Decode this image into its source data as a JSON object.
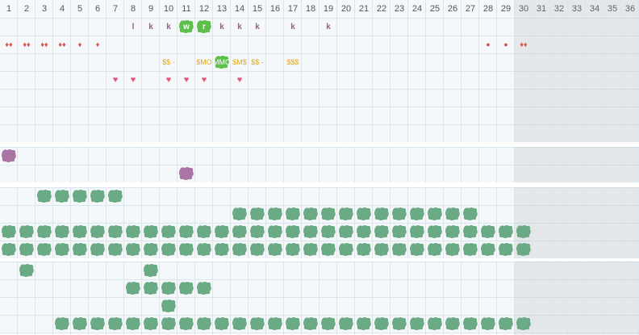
{
  "header": {
    "day_labels": [
      "1",
      "2",
      "3",
      "4",
      "5",
      "6",
      "7",
      "8",
      "9",
      "10",
      "11",
      "12",
      "13",
      "14",
      "15",
      "16",
      "17",
      "18",
      "19",
      "20",
      "21",
      "22",
      "23",
      "24",
      "25",
      "26",
      "27",
      "28",
      "29",
      "30",
      "31",
      "32",
      "33",
      "34",
      "35",
      "36"
    ]
  },
  "colors": {
    "grid_line": "#d8e6ee",
    "cell_bg": "#f4f8fb",
    "weekend_shade": "#ececec",
    "k_letter": "#9b5a8e",
    "drop": "#d9534f",
    "heart": "#e05a7a",
    "money": "#e6a817",
    "highlight_green": "#5cc04a",
    "blob_green": "#6aab85",
    "blob_purple": "#a875a5"
  },
  "rows": {
    "letters": [
      {
        "col": 8,
        "text": "l"
      },
      {
        "col": 9,
        "text": "k"
      },
      {
        "col": 10,
        "text": "k"
      },
      {
        "col": 11,
        "text": "w",
        "highlight": true
      },
      {
        "col": 12,
        "text": "r",
        "highlight": true
      },
      {
        "col": 13,
        "text": "k"
      },
      {
        "col": 14,
        "text": "k"
      },
      {
        "col": 15,
        "text": "k"
      },
      {
        "col": 17,
        "text": "k"
      },
      {
        "col": 19,
        "text": "k"
      }
    ],
    "drops": [
      {
        "col": 1,
        "symbol": "♦♦"
      },
      {
        "col": 2,
        "symbol": "♦♦"
      },
      {
        "col": 3,
        "symbol": "♦♦"
      },
      {
        "col": 4,
        "symbol": "♦♦"
      },
      {
        "col": 5,
        "symbol": "♦"
      },
      {
        "col": 6,
        "symbol": "♦"
      },
      {
        "col": 28,
        "symbol": "●"
      },
      {
        "col": 29,
        "symbol": "●"
      },
      {
        "col": 30,
        "symbol": "♦♦"
      }
    ],
    "money": [
      {
        "col": 10,
        "text": "$$ -"
      },
      {
        "col": 12,
        "text": "$MO"
      },
      {
        "col": 13,
        "text": "MMO",
        "highlight": true
      },
      {
        "col": 14,
        "text": "$M$"
      },
      {
        "col": 15,
        "text": "$$ -"
      },
      {
        "col": 17,
        "text": "$$$"
      }
    ],
    "hearts": [
      {
        "col": 7,
        "symbol": "♥"
      },
      {
        "col": 8,
        "symbol": "♥"
      },
      {
        "col": 10,
        "symbol": "♥"
      },
      {
        "col": 11,
        "symbol": "♥"
      },
      {
        "col": 12,
        "symbol": "♥"
      },
      {
        "col": 14,
        "symbol": "♥"
      }
    ]
  },
  "blobs": {
    "purple": [
      {
        "row": 0,
        "col": 1
      },
      {
        "row": 1,
        "col": 11
      }
    ],
    "green_section3": [
      {
        "row": 0,
        "cols": [
          3,
          4,
          5,
          6,
          7
        ]
      },
      {
        "row": 1,
        "cols": [
          14,
          15,
          16,
          17,
          18,
          19,
          20,
          21,
          22,
          23,
          24,
          25,
          26,
          27
        ]
      },
      {
        "row": 2,
        "cols": [
          1,
          2,
          3,
          4,
          5,
          6,
          7,
          8,
          9,
          10,
          11,
          12,
          13,
          14,
          15,
          16,
          17,
          18,
          19,
          20,
          21,
          22,
          23,
          24,
          25,
          26,
          27,
          28,
          29,
          30
        ]
      },
      {
        "row": 3,
        "cols": [
          1,
          2,
          3,
          4,
          5,
          6,
          7,
          8,
          9,
          10,
          11,
          12,
          13,
          14,
          15,
          16,
          17,
          18,
          19,
          20,
          21,
          22,
          23,
          24,
          25,
          26,
          27,
          28,
          29,
          30
        ]
      }
    ],
    "green_section4": [
      {
        "row": 0,
        "cols": [
          2,
          9
        ]
      },
      {
        "row": 1,
        "cols": [
          8,
          9,
          10,
          11,
          12
        ]
      },
      {
        "row": 2,
        "cols": [
          10
        ]
      },
      {
        "row": 3,
        "cols": [
          4,
          5,
          6,
          7,
          8,
          9,
          10,
          11,
          12,
          13,
          14,
          15,
          16,
          17,
          18,
          19,
          20,
          21,
          22,
          23,
          24,
          25,
          26,
          27,
          28,
          29,
          30
        ]
      }
    ]
  }
}
